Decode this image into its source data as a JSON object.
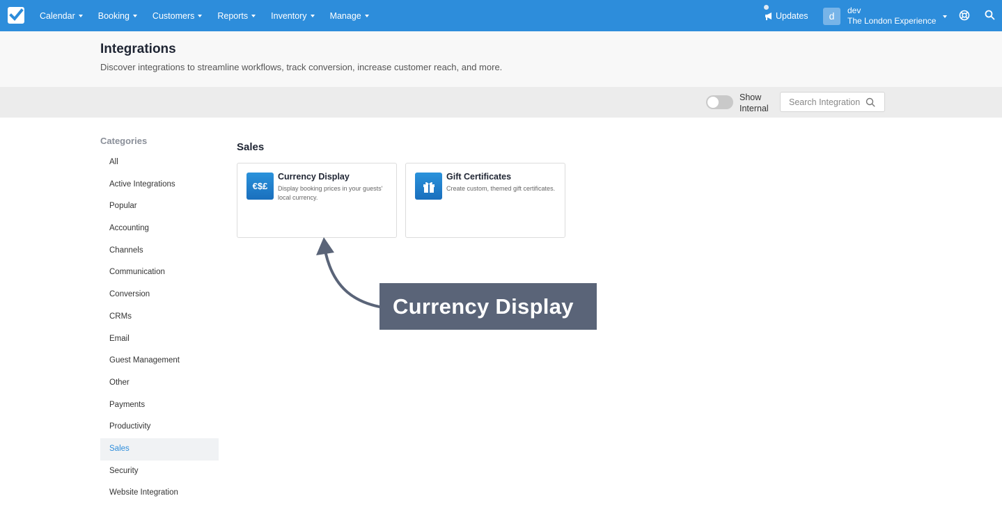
{
  "nav": {
    "items": [
      {
        "label": "Calendar"
      },
      {
        "label": "Booking"
      },
      {
        "label": "Customers"
      },
      {
        "label": "Reports"
      },
      {
        "label": "Inventory"
      },
      {
        "label": "Manage"
      }
    ],
    "updates_label": "Updates",
    "user": {
      "avatar_letter": "d",
      "name": "dev",
      "company": "The London Experience"
    }
  },
  "header": {
    "title": "Integrations",
    "subtitle": "Discover integrations to streamline workflows, track conversion, increase customer reach, and more."
  },
  "toolbar": {
    "toggle_label_line1": "Show",
    "toggle_label_line2": "Internal",
    "toggle_on": false,
    "search_placeholder": "Search Integration"
  },
  "sidebar": {
    "title": "Categories",
    "items": [
      {
        "label": "All"
      },
      {
        "label": "Active Integrations"
      },
      {
        "label": "Popular"
      },
      {
        "label": "Accounting"
      },
      {
        "label": "Channels"
      },
      {
        "label": "Communication"
      },
      {
        "label": "Conversion"
      },
      {
        "label": "CRMs"
      },
      {
        "label": "Email"
      },
      {
        "label": "Guest Management"
      },
      {
        "label": "Other"
      },
      {
        "label": "Payments"
      },
      {
        "label": "Productivity"
      },
      {
        "label": "Sales"
      },
      {
        "label": "Security"
      },
      {
        "label": "Website Integration"
      }
    ],
    "active": "Sales"
  },
  "main": {
    "section_title": "Sales",
    "cards": [
      {
        "name": "Currency Display",
        "description": "Display booking prices in your guests' local currency.",
        "icon": "currency-icon",
        "icon_text": "€$£"
      },
      {
        "name": "Gift Certificates",
        "description": "Create custom, themed gift certificates.",
        "icon": "gift-icon"
      }
    ]
  },
  "annotation": {
    "callout_text": "Currency Display"
  },
  "colors": {
    "brand": "#2d8ddb",
    "callout_bg": "#5a6478",
    "active_text": "#2d8ddb"
  }
}
